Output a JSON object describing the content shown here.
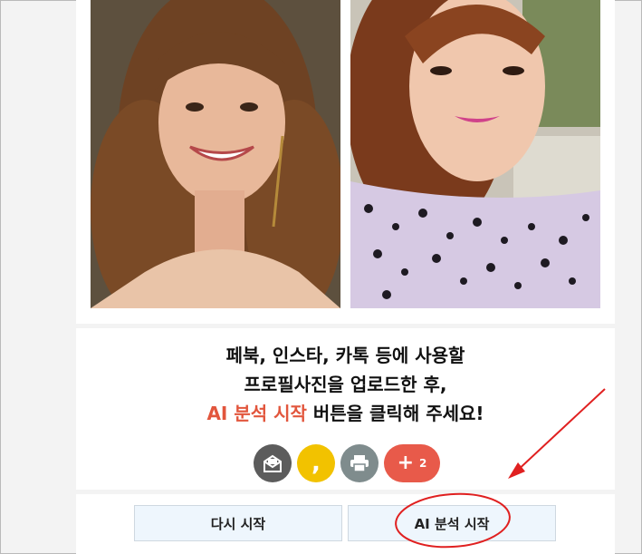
{
  "photos": [
    {
      "alt": "woman-portrait-left"
    },
    {
      "alt": "woman-portrait-right"
    }
  ],
  "instructions": {
    "line1": "페북, 인스타, 카톡 등에 사용할",
    "line2": "프로필사진을 업로드한 후,",
    "line3_highlight": "AI 분석 시작",
    "line3_rest": " 버튼을 클릭해 주세요!"
  },
  "share": {
    "icons": [
      "mail-icon",
      "kakao-comma-icon",
      "print-icon",
      "plus-icon"
    ],
    "talk_glyph": ",",
    "more_count": "2"
  },
  "buttons": {
    "restart_label": "다시 시작",
    "start_label": "AI 분석 시작"
  },
  "colors": {
    "accent": "#e2563d",
    "annotation": "#e02020",
    "button_bg": "#eef6fd"
  }
}
